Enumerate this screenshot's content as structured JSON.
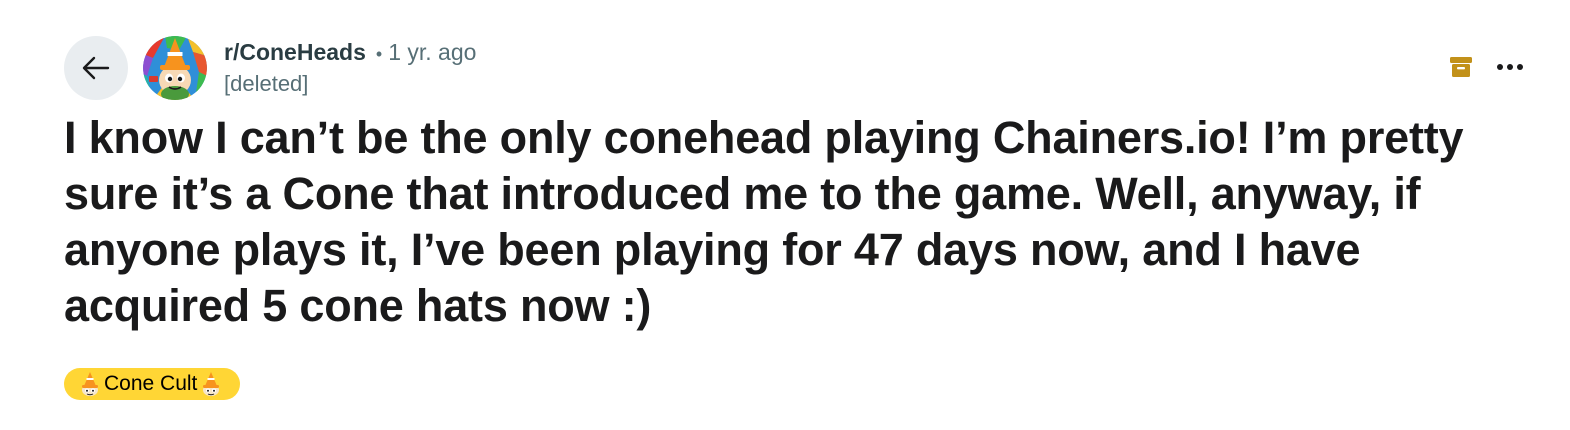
{
  "post": {
    "subreddit": "r/ConeHeads",
    "separator": "•",
    "time_ago": "1 yr. ago",
    "author": "[deleted]",
    "title": "I know I can’t be the only conehead playing Chainers.io! I’m pretty sure it’s a Cone that introduced me to the game. Well, anyway, if anyone plays it, I’ve been playing for 47 days now, and I have acquired 5 cone hats now :)",
    "flair": "Cone Cult"
  },
  "icons": {
    "back": "arrow-left-icon",
    "avatar": "coneheads-community-avatar",
    "archive": "archive-icon",
    "more": "more-options-icon",
    "flair_emoji": "cone-emoji-icon"
  },
  "colors": {
    "flair_bg": "#ffd635",
    "archive": "#c2911a",
    "back_bg": "#e9edf0",
    "meta": "#576f76"
  }
}
